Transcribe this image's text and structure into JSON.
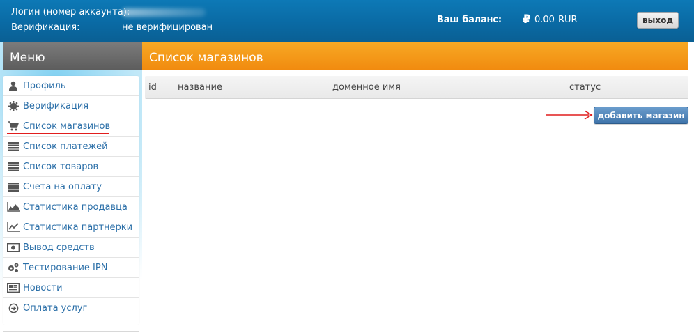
{
  "header": {
    "login_label": "Логин (номер аккаунта):",
    "verification_label": "Верификация:",
    "verification_value": "не верифицирован",
    "balance_label": "Ваш баланс:",
    "balance_amount": "0.00",
    "balance_currency": "RUR",
    "logout_label": "выход"
  },
  "menu": {
    "title": "Меню",
    "items": [
      {
        "label": "Профиль",
        "icon": "user-icon"
      },
      {
        "label": "Верификация",
        "icon": "gear-badge-icon"
      },
      {
        "label": "Список магазинов",
        "icon": "cart-icon",
        "active": true
      },
      {
        "label": "Список платежей",
        "icon": "list-icon"
      },
      {
        "label": "Список товаров",
        "icon": "list-icon"
      },
      {
        "label": "Счета на оплату",
        "icon": "list-icon"
      },
      {
        "label": "Статистика продавца",
        "icon": "area-chart-icon"
      },
      {
        "label": "Статистика партнерки",
        "icon": "line-chart-icon"
      },
      {
        "label": "Вывод средств",
        "icon": "banknote-icon"
      },
      {
        "label": "Тестирование IPN",
        "icon": "cogs-icon"
      },
      {
        "label": "Новости",
        "icon": "newspaper-icon"
      },
      {
        "label": "Оплата услуг",
        "icon": "circle-arrow-icon"
      }
    ]
  },
  "main": {
    "title": "Список магазинов",
    "table": {
      "columns": [
        "id",
        "название",
        "доменное имя",
        "статус"
      ],
      "rows": []
    },
    "add_button_label": "добавить магазин"
  },
  "colors": {
    "header_blue": "#0a6aa4",
    "menu_head_gray": "#6b6b6b",
    "content_head_orange": "#f39a18",
    "link_blue": "#2b6fa8",
    "annotation_red": "#e11d1d",
    "button_blue": "#4f84b8"
  }
}
